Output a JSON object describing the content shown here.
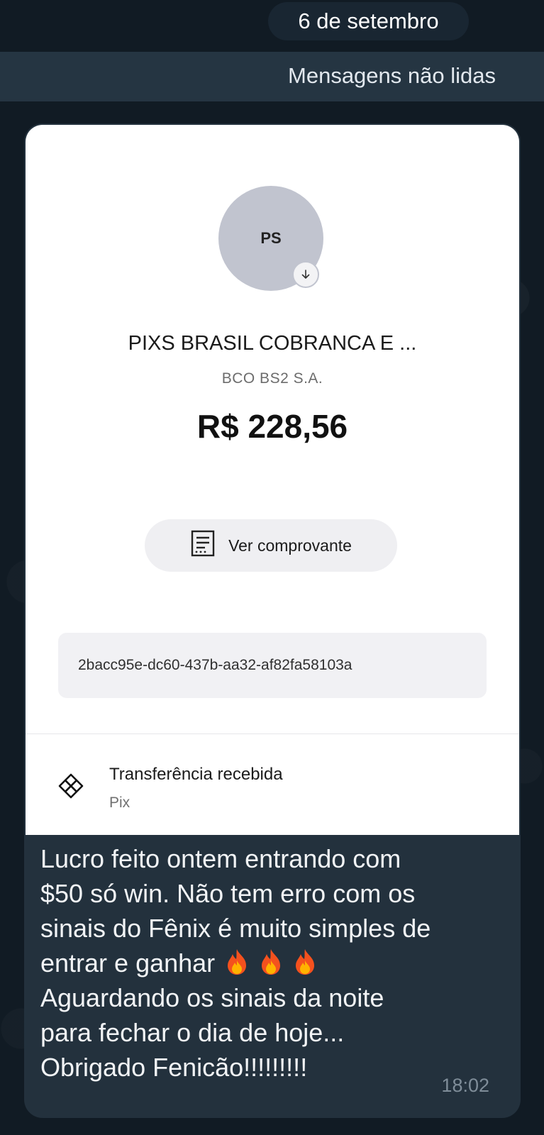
{
  "header": {
    "date_label": "6 de setembro",
    "unread_label": "Mensagens não lidas"
  },
  "receipt": {
    "avatar_initials": "PS",
    "payee_name": "PIXS BRASIL COBRANCA E ...",
    "bank_name": "BCO BS2 S.A.",
    "amount": "R$ 228,56",
    "view_receipt_label": "Ver comprovante",
    "transaction_id": "2bacc95e-dc60-437b-aa32-af82fa58103a",
    "transaction_type": "Transferência recebida",
    "transaction_method": "Pix"
  },
  "message": {
    "lines": [
      "Lucro feito ontem entrando com",
      "$50 só win. Não tem erro com os",
      "sinais do Fênix é muito simples de",
      "entrar e ganhar",
      "Aguardando os sinais da noite",
      "para fechar o dia de hoje...",
      "Obrigado Fenicão!!!!!!!!!"
    ],
    "emoji_icons": [
      "fire-icon",
      "fire-icon",
      "fire-icon"
    ],
    "time": "18:02"
  },
  "colors": {
    "background": "#111b24",
    "bubble": "#23313d",
    "unread_bar": "#253542",
    "avatar": "#c1c4cf"
  }
}
